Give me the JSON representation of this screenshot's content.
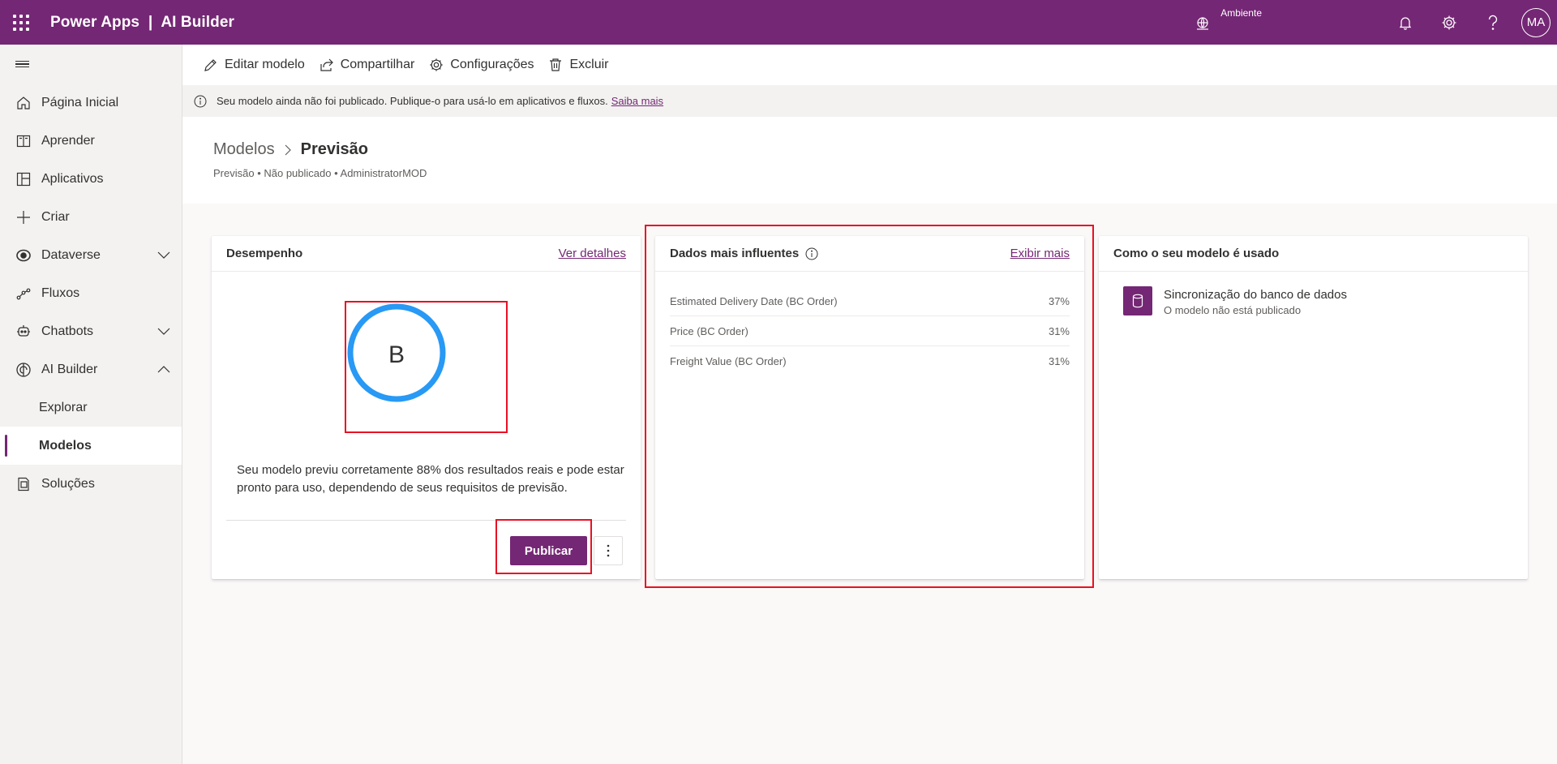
{
  "topbar": {
    "title": "Power Apps  |  AI Builder",
    "environment_label": "Ambiente",
    "avatar": "MA",
    "background_color": "#742774"
  },
  "sidebar": {
    "items": [
      {
        "label": "Página Inicial",
        "icon": "home-icon"
      },
      {
        "label": "Aprender",
        "icon": "book-icon"
      },
      {
        "label": "Aplicativos",
        "icon": "apps-icon"
      },
      {
        "label": "Criar",
        "icon": "plus-icon"
      },
      {
        "label": "Dataverse",
        "icon": "dataverse-icon",
        "expandable": true,
        "expanded": false
      },
      {
        "label": "Fluxos",
        "icon": "flow-icon"
      },
      {
        "label": "Chatbots",
        "icon": "chatbot-icon",
        "expandable": true,
        "expanded": false
      },
      {
        "label": "AI Builder",
        "icon": "ai-builder-icon",
        "expandable": true,
        "expanded": true
      },
      {
        "label": "Explorar",
        "sub": true
      },
      {
        "label": "Modelos",
        "sub": true,
        "active": true
      },
      {
        "label": "Soluções",
        "icon": "solutions-icon"
      }
    ]
  },
  "commands": {
    "edit": "Editar modelo",
    "share": "Compartilhar",
    "settings": "Configurações",
    "delete": "Excluir"
  },
  "infobar": {
    "message": "Seu modelo ainda não foi publicado. Publique-o para usá-lo em aplicativos e fluxos.",
    "link": "Saiba mais"
  },
  "header": {
    "breadcrumb_parent": "Modelos",
    "breadcrumb_current": "Previsão",
    "subinfo": "Previsão • Não publicado • AdministratorMOD"
  },
  "performance": {
    "title": "Desempenho",
    "link": "Ver detalhes",
    "grade": "B",
    "description": "Seu modelo previu corretamente 88% dos resultados reais e pode estar pronto para uso, dependendo de seus requisitos de previsão.",
    "publish_label": "Publicar"
  },
  "influential": {
    "title": "Dados mais influentes",
    "link": "Exibir mais",
    "rows": [
      {
        "name": "Estimated Delivery Date (BC Order)",
        "value": "37%"
      },
      {
        "name": "Price (BC Order)",
        "value": "31%"
      },
      {
        "name": "Freight Value (BC Order)",
        "value": "31%"
      }
    ]
  },
  "usage": {
    "title": "Como o seu modelo é usado",
    "item_title": "Sincronização do banco de dados",
    "item_subtitle": "O modelo não está publicado"
  },
  "colors": {
    "accent": "#742774",
    "ring": "#2899f5",
    "highlight": "#e81123"
  }
}
